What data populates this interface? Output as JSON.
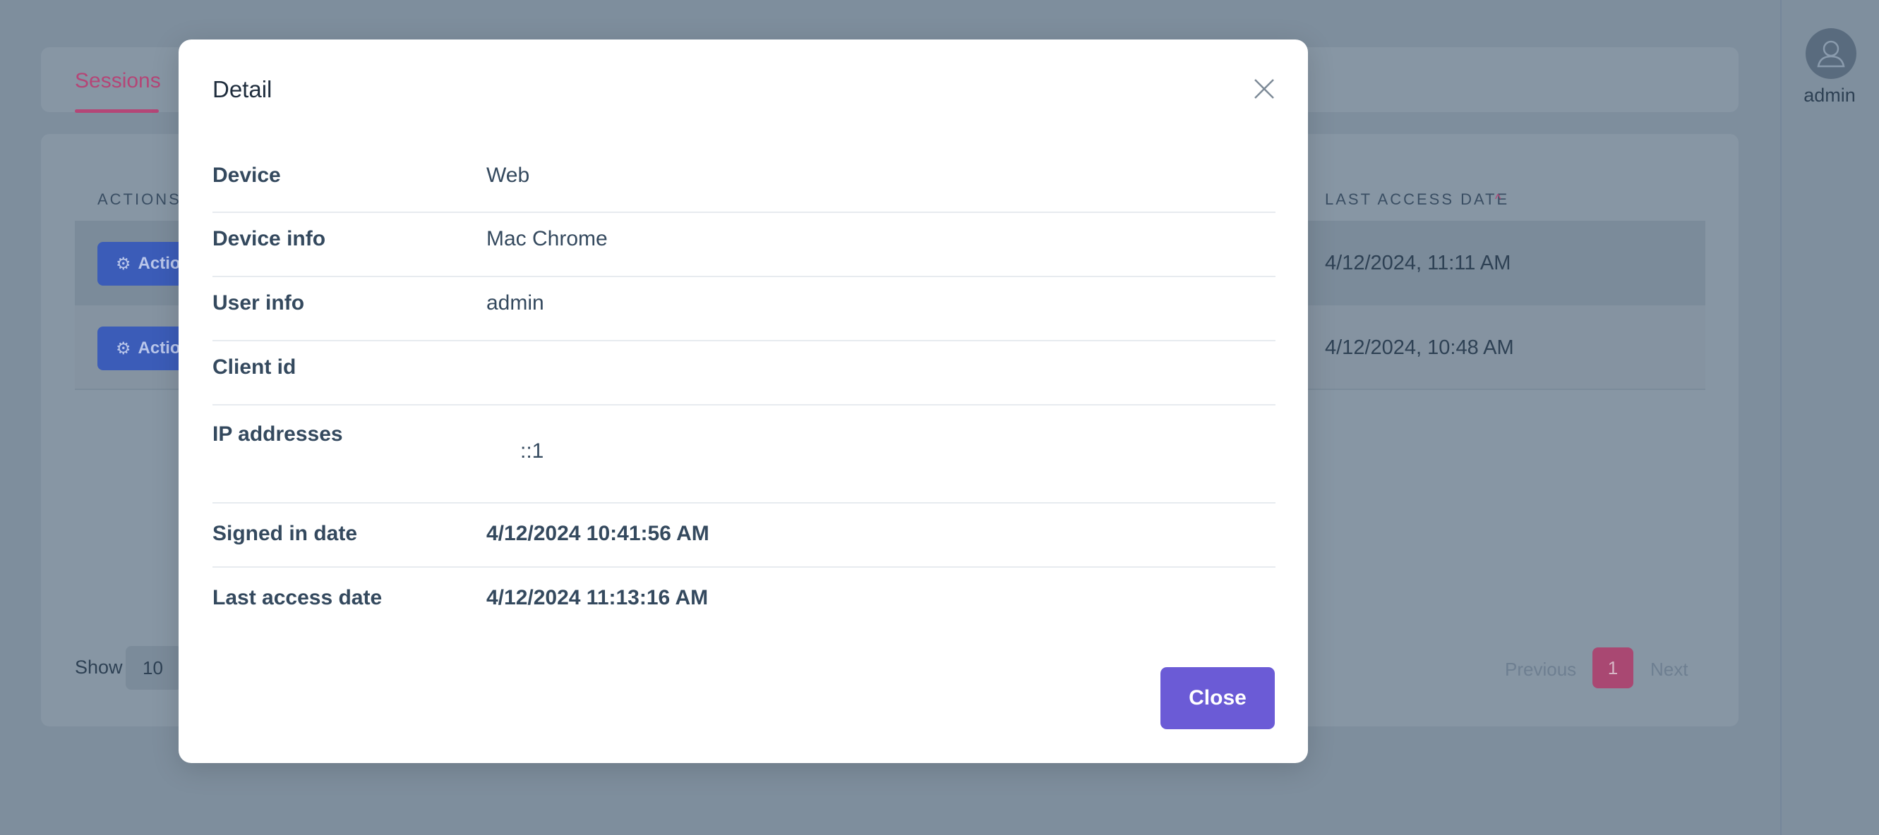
{
  "tabs": {
    "sessions": "Sessions"
  },
  "user": {
    "name": "admin",
    "avatar_icon": "user-icon"
  },
  "table": {
    "header_actions": "ACTIONS",
    "header_last_access": "LAST ACCESS DATE",
    "action_label": "Actio",
    "rows": [
      {
        "last_access": "4/12/2024, 11:11 AM"
      },
      {
        "last_access": "4/12/2024, 10:48 AM"
      }
    ]
  },
  "footer": {
    "show_label": "Show",
    "page_size": "10",
    "previous": "Previous",
    "current_page": "1",
    "next": "Next"
  },
  "modal": {
    "title": "Detail",
    "fields": {
      "device": {
        "label": "Device",
        "value": "Web"
      },
      "device_info": {
        "label": "Device info",
        "value": "Mac Chrome"
      },
      "user_info": {
        "label": "User info",
        "value": "admin"
      },
      "client_id": {
        "label": "Client id",
        "value": ""
      },
      "ip_addresses": {
        "label": "IP addresses",
        "value": "::1"
      },
      "signed_in_date": {
        "label": "Signed in date",
        "value": "4/12/2024 10:41:56 AM"
      },
      "last_access_date": {
        "label": "Last access date",
        "value": "4/12/2024 11:13:16 AM"
      }
    },
    "close_button": "Close"
  },
  "colors": {
    "accent": "#b44677",
    "primary_button": "#6b5bd6",
    "action_button": "#3b5cb8",
    "overlay": "#7e8e9d"
  }
}
